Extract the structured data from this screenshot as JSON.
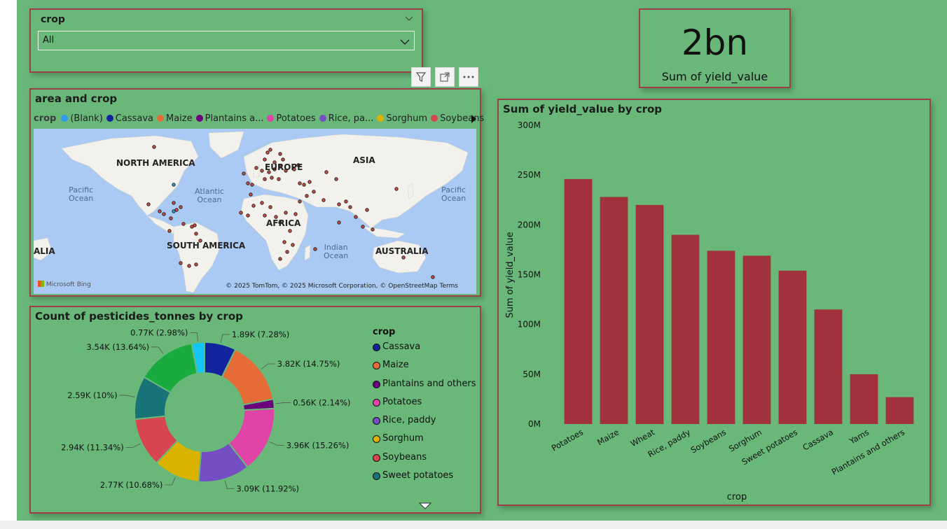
{
  "slicer": {
    "title": "crop",
    "selected": "All"
  },
  "kpi": {
    "value": "2bn",
    "label": "Sum of yield_value"
  },
  "map": {
    "title": "area and crop",
    "legend_title": "crop",
    "legend": [
      {
        "label": "(Blank)",
        "color": "#2d9bf0"
      },
      {
        "label": "Cassava",
        "color": "#12239e"
      },
      {
        "label": "Maize",
        "color": "#e66c37"
      },
      {
        "label": "Plantains a...",
        "color": "#6b007b"
      },
      {
        "label": "Potatoes",
        "color": "#e044a7"
      },
      {
        "label": "Rice, pa...",
        "color": "#744ec2"
      },
      {
        "label": "Sorghum",
        "color": "#d9b300"
      },
      {
        "label": "Soybeans",
        "color": "#d64550"
      }
    ],
    "labels": {
      "north_america": "NORTH AMERICA",
      "europe": "EUROPE",
      "asia": "ASIA",
      "africa": "AFRICA",
      "south_america": "SOUTH AMERICA",
      "australia": "AUSTRALIA",
      "alia": "ALIA",
      "pacific_left_1": "Pacific",
      "pacific_left_2": "Ocean",
      "atlantic_1": "Atlantic",
      "atlantic_2": "Ocean",
      "indian_1": "Indian",
      "indian_2": "Ocean",
      "pacific_right_1": "Pacific",
      "pacific_right_2": "Ocean"
    },
    "bing": "Microsoft Bing",
    "copyright": "© 2025 TomTom, © 2025 Microsoft Corporation, © OpenStreetMap  Terms"
  },
  "donut": {
    "title": "Count of pesticides_tonnes by crop",
    "legend_title": "crop",
    "legend": [
      {
        "label": "Cassava",
        "color": "#12239e"
      },
      {
        "label": "Maize",
        "color": "#e66c37"
      },
      {
        "label": "Plantains and others",
        "color": "#6b007b"
      },
      {
        "label": "Potatoes",
        "color": "#e044a7"
      },
      {
        "label": "Rice, paddy",
        "color": "#744ec2"
      },
      {
        "label": "Sorghum",
        "color": "#d9b300"
      },
      {
        "label": "Soybeans",
        "color": "#d64550"
      },
      {
        "label": "Sweet potatoes",
        "color": "#197278"
      }
    ]
  },
  "chart_data": [
    {
      "type": "pie",
      "title": "Count of pesticides_tonnes by crop",
      "slices": [
        {
          "name": "Cassava",
          "value": 1.89,
          "label": "1.89K (7.28%)",
          "color": "#12239e"
        },
        {
          "name": "Maize",
          "value": 3.82,
          "label": "3.82K (14.75%)",
          "color": "#e66c37"
        },
        {
          "name": "Plantains and others",
          "value": 0.56,
          "label": "0.56K (2.14%)",
          "color": "#6b007b"
        },
        {
          "name": "Potatoes",
          "value": 3.96,
          "label": "3.96K (15.26%)",
          "color": "#e044a7"
        },
        {
          "name": "Rice, paddy",
          "value": 3.09,
          "label": "3.09K (11.92%)",
          "color": "#744ec2"
        },
        {
          "name": "Sorghum",
          "value": 2.77,
          "label": "2.77K (10.68%)",
          "color": "#d9b300"
        },
        {
          "name": "Soybeans",
          "value": 2.94,
          "label": "2.94K (11.34%)",
          "color": "#d64550"
        },
        {
          "name": "Sweet potatoes",
          "value": 2.59,
          "label": "2.59K (10%)",
          "color": "#197278"
        },
        {
          "name": "Wheat",
          "value": 3.54,
          "label": "3.54K (13.64%)",
          "color": "#1aab40"
        },
        {
          "name": "Yams",
          "value": 0.77,
          "label": "0.77K (2.98%)",
          "color": "#15c6f4"
        }
      ]
    },
    {
      "type": "bar",
      "title": "Sum of yield_value by crop",
      "xlabel": "crop",
      "ylabel": "Sum of yield_value",
      "categories": [
        "Potatoes",
        "Maize",
        "Wheat",
        "Rice, paddy",
        "Soybeans",
        "Sorghum",
        "Sweet potatoes",
        "Cassava",
        "Yams",
        "Plantains and others"
      ],
      "values": [
        246,
        228,
        220,
        190,
        174,
        169,
        154,
        115,
        50,
        27
      ],
      "yticks": [
        "0M",
        "50M",
        "100M",
        "150M",
        "200M",
        "250M",
        "300M"
      ],
      "ylim": [
        0,
        300
      ],
      "bar_color": "#a0313d"
    }
  ]
}
